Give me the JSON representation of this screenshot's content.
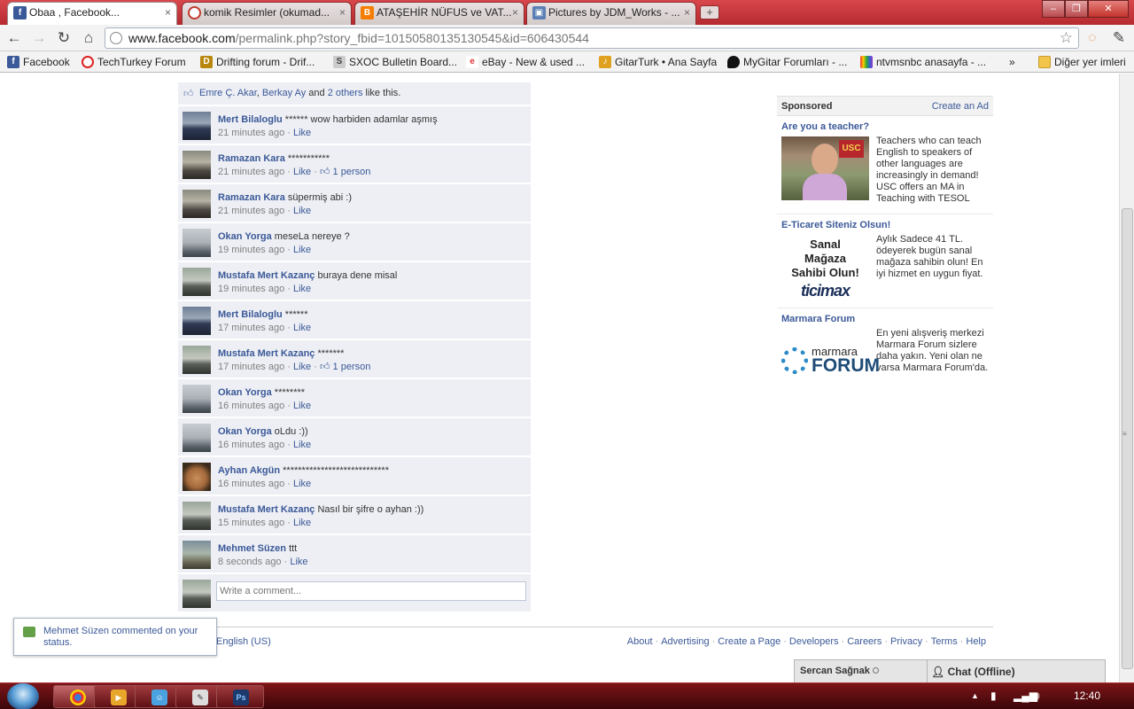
{
  "browser": {
    "tabs": [
      {
        "title": "Obaa , Facebook...",
        "icon": "facebook-icon",
        "active": true
      },
      {
        "title": "komik Resimler (okumad...",
        "icon": "tab-site-icon",
        "active": false
      },
      {
        "title": "ATAŞEHİR NÜFUS ve VAT...",
        "icon": "blogger-icon",
        "active": false
      },
      {
        "title": "Pictures by JDM_Works - ...",
        "icon": "photo-icon",
        "active": false
      }
    ],
    "url_host": "www.facebook.com",
    "url_path": "/permalink.php?story_fbid=10150580135130545&id=606430544",
    "bookmarks": [
      {
        "label": "Facebook",
        "icon": "facebook-icon"
      },
      {
        "label": "TechTurkey Forum",
        "icon": "techturkey-icon"
      },
      {
        "label": "Drifting forum - Drif...",
        "icon": "drifting-icon"
      },
      {
        "label": "SXOC Bulletin Board...",
        "icon": "sxoc-icon"
      },
      {
        "label": "eBay - New & used ...",
        "icon": "ebay-icon"
      },
      {
        "label": "GitarTurk • Ana Sayfa",
        "icon": "guitar-icon"
      },
      {
        "label": "MyGitar Forumları - ...",
        "icon": "pick-icon"
      },
      {
        "label": "ntvmsnbc anasayfa - ...",
        "icon": "nbc-icon"
      }
    ],
    "other_bookmarks": "Diğer yer imleri",
    "chevron": "»"
  },
  "likes": {
    "name1": "Emre Ç. Akar",
    "sep": ", ",
    "name2": "Berkay Ay",
    "and": " and ",
    "others": "2 others",
    "suffix": " like this."
  },
  "comments": [
    {
      "author": "Mert Bilaloglu",
      "text": " ****** wow harbiden adamlar aşmış",
      "time": "21 minutes ago",
      "like": "Like",
      "likes": "",
      "avatar": "car"
    },
    {
      "author": "Ramazan Kara",
      "text": " ***********",
      "time": "21 minutes ago",
      "like": "Like",
      "likes": "1 person",
      "avatar": "crowd"
    },
    {
      "author": "Ramazan Kara",
      "text": " süpermiş abi :)",
      "time": "21 minutes ago",
      "like": "Like",
      "likes": "",
      "avatar": "crowd"
    },
    {
      "author": "Okan Yorga",
      "text": " meseLa nereye ?",
      "time": "19 minutes ago",
      "like": "Like",
      "likes": "",
      "avatar": "mist"
    },
    {
      "author": "Mustafa Mert Kazanç",
      "text": " buraya dene misal",
      "time": "19 minutes ago",
      "like": "Like",
      "likes": "",
      "avatar": "car2"
    },
    {
      "author": "Mert Bilaloglu",
      "text": " ******",
      "time": "17 minutes ago",
      "like": "Like",
      "likes": "",
      "avatar": "car"
    },
    {
      "author": "Mustafa Mert Kazanç",
      "text": " *******",
      "time": "17 minutes ago",
      "like": "Like",
      "likes": "1 person",
      "avatar": "car2"
    },
    {
      "author": "Okan Yorga",
      "text": " ********",
      "time": "16 minutes ago",
      "like": "Like",
      "likes": "",
      "avatar": "mist"
    },
    {
      "author": "Okan Yorga",
      "text": " oLdu :))",
      "time": "16 minutes ago",
      "like": "Like",
      "likes": "",
      "avatar": "mist"
    },
    {
      "author": "Ayhan Akgün",
      "text": " ****************************",
      "time": "16 minutes ago",
      "like": "Like",
      "likes": "",
      "avatar": "face"
    },
    {
      "author": "Mustafa Mert Kazanç",
      "text": " Nasıl bir şifre o ayhan :))",
      "time": "15 minutes ago",
      "like": "Like",
      "likes": "",
      "avatar": "car2"
    },
    {
      "author": "Mehmet Süzen",
      "text": " ttt",
      "time": "8 seconds ago",
      "like": "Like",
      "likes": "",
      "avatar": "street"
    }
  ],
  "meta_sep": " · ",
  "write_comment_placeholder": "Write a comment...",
  "sponsored": {
    "title": "Sponsored",
    "create_ad": "Create an Ad",
    "ads": [
      {
        "title": "Are you a teacher?",
        "text": "Teachers who can teach English to speakers of other languages are increasingly in demand! USC offers an MA in Teaching with TESOL",
        "img_badge": "USC"
      },
      {
        "title": "E-Ticaret Siteniz Olsun!",
        "text": "Aylık Sadece 41 TL. ödeyerek bugün sanal mağaza sahibin olun! En iyi hizmet en uygun fiyat.",
        "img_line1": "Sanal",
        "img_line2": "Mağaza",
        "img_line3": "Sahibi Olun!",
        "img_brand": "ticimax"
      },
      {
        "title": "Marmara Forum",
        "text": "En yeni alışveriş merkezi Marmara Forum sizlere daha yakın. Yeni olan ne varsa Marmara Forum'da.",
        "img_word1": "marmara",
        "img_word2": "FORUM"
      }
    ]
  },
  "footer": {
    "language": "English (US)",
    "links": [
      "About",
      "Advertising",
      "Create a Page",
      "Developers",
      "Careers",
      "Privacy",
      "Terms",
      "Help"
    ],
    "sep": "·"
  },
  "notification": {
    "text": "Mehmet Süzen commented on your status."
  },
  "chat": {
    "owner": "Sercan Sağnak",
    "status": "Chat (Offline)"
  },
  "taskbar": {
    "apps": [
      "chrome-icon",
      "media-player-icon",
      "messenger-icon",
      "paint-icon",
      "photoshop-icon"
    ],
    "photoshop_label": "Ps",
    "tray_arrow": "▲",
    "clock": "12:40"
  }
}
